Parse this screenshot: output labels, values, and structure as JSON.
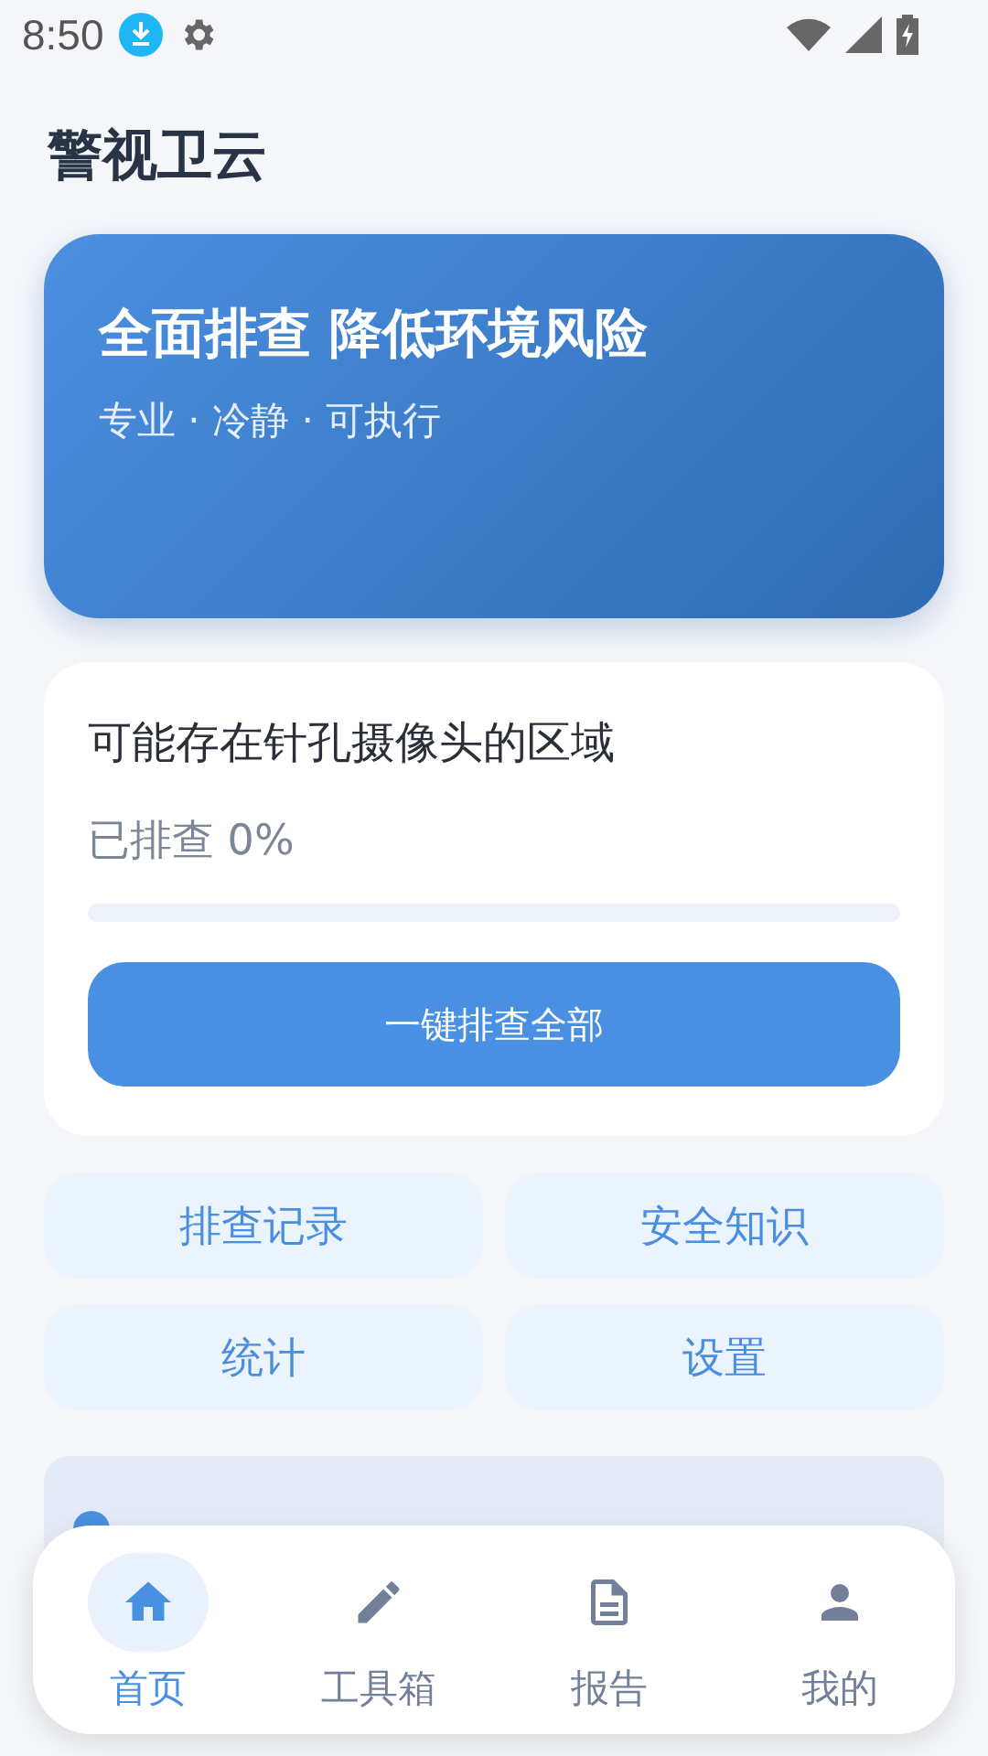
{
  "status_bar": {
    "time": "8:50"
  },
  "app_title": "警视卫云",
  "hero": {
    "title": "全面排查 降低环境风险",
    "subtitle": "专业 · 冷静 · 可执行"
  },
  "scan_card": {
    "title": "可能存在针孔摄像头的区域",
    "progress_label": "已排查 0%",
    "level": 0,
    "button": "一键排查全部"
  },
  "quick_actions": [
    "排查记录",
    "安全知识",
    "统计",
    "设置"
  ],
  "bottom_nav": [
    {
      "label": "首页",
      "selected": true
    },
    {
      "label": "工具箱",
      "selected": false
    },
    {
      "label": "报告",
      "selected": false
    },
    {
      "label": "我的",
      "selected": false
    }
  ]
}
